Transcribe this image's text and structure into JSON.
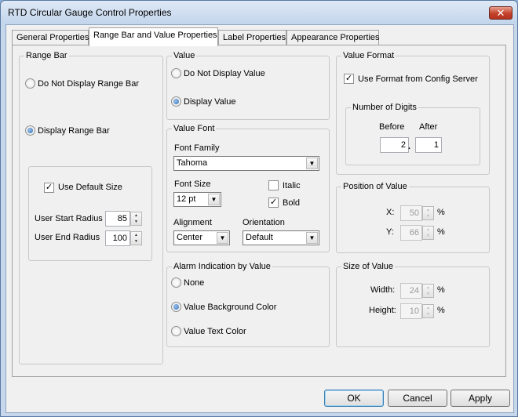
{
  "window": {
    "title": "RTD Circular Gauge Control Properties",
    "close_glyph": "✕"
  },
  "tabs": [
    {
      "label": "General Properties"
    },
    {
      "label": "Range Bar and Value Properties"
    },
    {
      "label": "Label Properties"
    },
    {
      "label": "Appearance Properties"
    }
  ],
  "range_bar": {
    "title": "Range Bar",
    "do_not_display": "Do Not Display Range Bar",
    "display": "Display Range Bar",
    "use_default_size": "Use Default Size",
    "start_radius_label": "User Start Radius",
    "start_radius_value": "85",
    "end_radius_label": "User End Radius",
    "end_radius_value": "100"
  },
  "value": {
    "title": "Value",
    "do_not_display": "Do Not Display Value",
    "display": "Display Value"
  },
  "value_font": {
    "title": "Value Font",
    "family_label": "Font Family",
    "family_value": "Tahoma",
    "size_label": "Font Size",
    "size_value": "12 pt",
    "italic_label": "Italic",
    "bold_label": "Bold",
    "alignment_label": "Alignment",
    "alignment_value": "Center",
    "orientation_label": "Orientation",
    "orientation_value": "Default"
  },
  "alarm": {
    "title": "Alarm Indication by Value",
    "none": "None",
    "background": "Value Background Color",
    "text": "Value Text Color"
  },
  "value_format": {
    "title": "Value Format",
    "use_config": "Use Format from Config Server",
    "digits_title": "Number of Digits",
    "before_label": "Before",
    "after_label": "After",
    "before_value": "2",
    "after_value": "1",
    "separator": "."
  },
  "position": {
    "title": "Position of Value",
    "x_label": "X:",
    "x_value": "50",
    "y_label": "Y:",
    "y_value": "66",
    "unit": "%"
  },
  "size": {
    "title": "Size of Value",
    "width_label": "Width:",
    "width_value": "24",
    "height_label": "Height:",
    "height_value": "10",
    "unit": "%"
  },
  "buttons": {
    "ok": "OK",
    "cancel": "Cancel",
    "apply": "Apply"
  },
  "glyphs": {
    "check": "✓",
    "up": "▲",
    "down": "▼",
    "dropdown": "▼"
  },
  "colors": {
    "titlebar": "#c2d5ec",
    "close": "#c4412a",
    "radio_fill": "#2d6ab3"
  }
}
